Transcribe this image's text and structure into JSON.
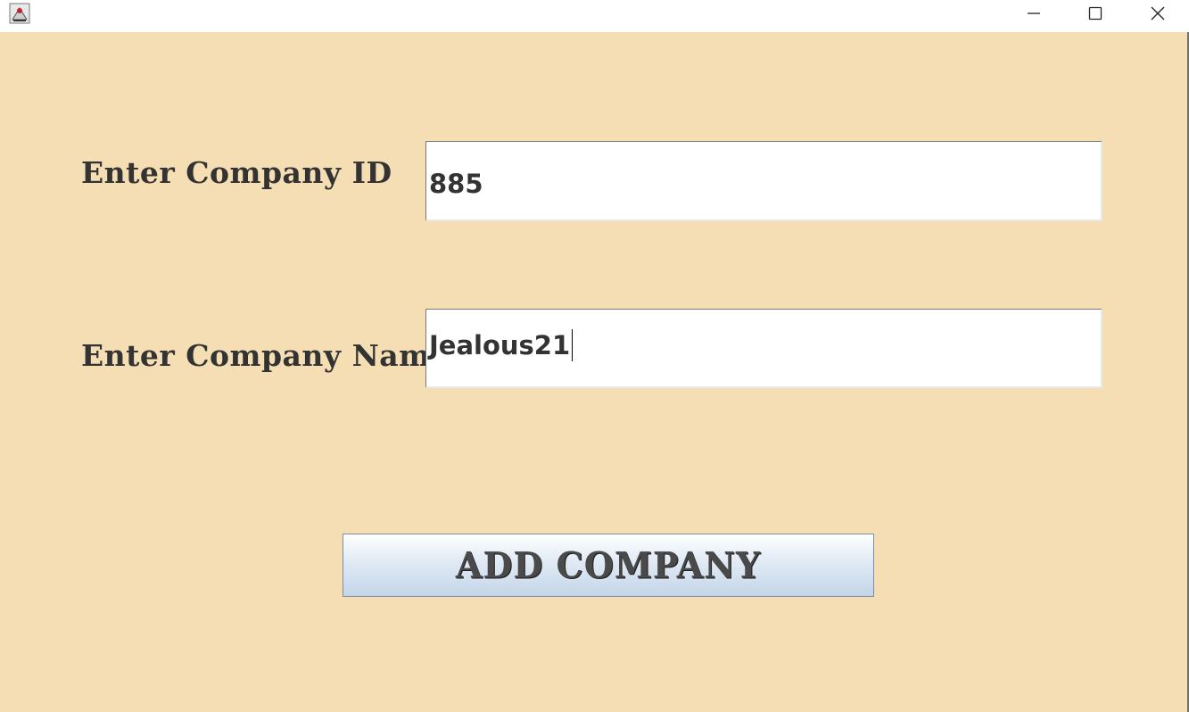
{
  "window": {
    "controls": {
      "minimize_icon": "minimize-icon",
      "maximize_icon": "maximize-icon",
      "close_icon": "close-icon"
    },
    "background_color": "#f5deb3"
  },
  "form": {
    "company_id_label": "Enter Company ID",
    "company_id_value": "885",
    "company_name_label": "Enter Company Name",
    "company_name_value": "Jealous21"
  },
  "actions": {
    "add_company_label": "ADD COMPANY"
  }
}
